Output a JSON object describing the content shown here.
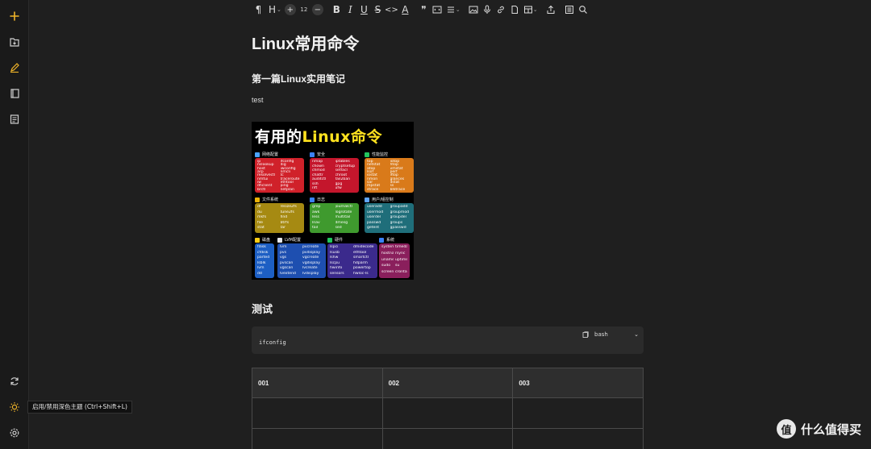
{
  "sidebar": {
    "items": [
      {
        "name": "new-note",
        "icon": "plus-icon"
      },
      {
        "name": "import",
        "icon": "folder-import-icon"
      },
      {
        "name": "edit",
        "icon": "pencil-icon"
      },
      {
        "name": "notebooks",
        "icon": "book-icon"
      },
      {
        "name": "outline",
        "icon": "list-icon"
      },
      {
        "name": "sync",
        "icon": "sync-icon"
      },
      {
        "name": "theme",
        "icon": "sun-icon"
      },
      {
        "name": "settings",
        "icon": "gear-icon"
      }
    ],
    "accent": "#f0b429"
  },
  "tooltip": "启用/禁用深色主题 (Ctrl+Shift+L)",
  "toolbar": {
    "paragraph": "¶",
    "heading": "H",
    "font_size": "12",
    "bold": "B",
    "italic": "I",
    "underline": "U",
    "strike": "S",
    "code": "<>",
    "text_color": "A",
    "quote": "❞"
  },
  "document": {
    "title": "Linux常用命令",
    "heading1": "第一篇Linux实用笔记",
    "paragraph": "test",
    "heading2": "测试",
    "code": {
      "language": "bash",
      "content": "ifconfig"
    },
    "table": {
      "headers": [
        "001",
        "002",
        "003"
      ],
      "rows": [
        [
          "",
          "",
          ""
        ],
        [
          "",
          "",
          ""
        ]
      ]
    }
  },
  "image": {
    "title_white": "有用的",
    "title_yellow": "Linux命令",
    "categories": [
      {
        "name": "网络配置",
        "color": "#d0212a",
        "icon_color": "#4aa3ff",
        "commands": [
          "ip",
          "ifconfig",
          "nslookup",
          "dig",
          "host",
          "iwconfig",
          "arp",
          "nmcli",
          "resolvectl",
          "tc",
          "nmtui",
          "traceroute",
          "iw",
          "ethtool",
          "dhclient",
          "ping",
          "brctl",
          "netplan"
        ]
      },
      {
        "name": "安全",
        "color": "#c4162c",
        "icon_color": "#3b82f6",
        "commands": [
          "nmap",
          "iptables",
          "chown",
          "cryptsetup",
          "chmod",
          "setfacl",
          "chattr",
          "chroot",
          "auditctl",
          "fail2ban",
          "ssh",
          "gpg",
          "nft",
          "ufw"
        ]
      },
      {
        "name": "性能监控",
        "color": "#d97a1a",
        "icon_color": "#22c55e",
        "commands": [
          "top",
          "iotop",
          "netstat",
          "htop",
          "atop",
          "vmstat",
          "lsof",
          "perf",
          "iostat",
          "iftop",
          "nmon",
          "glances",
          "sar",
          "dstat",
          "mpstat",
          "ss",
          "strace",
          "blktrace"
        ]
      },
      {
        "name": "文件系统",
        "color": "#a68a12",
        "icon_color": "#eab308",
        "commands": [
          "df",
          "resize2fs",
          "du",
          "tune2fs",
          "mkfs",
          "find",
          "file",
          "btrfs",
          "stat",
          "tar"
        ]
      },
      {
        "name": "日志",
        "color": "#3f9a2e",
        "icon_color": "#3b82f6",
        "commands": [
          "grep",
          "journalctl",
          "awk",
          "logrotate",
          "less",
          "multitail",
          "lnav",
          "dmesg",
          "tail",
          "sed"
        ]
      },
      {
        "name": "用户/组控制",
        "color": "#1f6e7a",
        "icon_color": "#60a5fa",
        "commands": [
          "useradd",
          "groupadd",
          "usermod",
          "groupmod",
          "userdel",
          "groupdel",
          "passwd",
          "groups",
          "getent",
          "gpasswd"
        ]
      },
      {
        "name": "磁盘",
        "color": "#1d5fc4",
        "icon_color": "#facc15",
        "commands": [
          "fdisk",
          "cfdisk",
          "parted",
          "lsblk",
          "lvm",
          "dd"
        ]
      },
      {
        "name": "LVM配置",
        "color": "#1e4fb0",
        "icon_color": "#e5e7eb",
        "commands": [
          "lvm",
          "pvcreate",
          "pvs",
          "pvdisplay",
          "vgs",
          "vgcreate",
          "pvscan",
          "vgdisplay",
          "vgscan",
          "lvcreate",
          "lvextend",
          "lvdisplay"
        ]
      },
      {
        "name": "硬件",
        "color": "#3b2a8c",
        "icon_color": "#22c55e",
        "commands": [
          "lspci",
          "dmidecode",
          "lsusb",
          "ethtool",
          "lshw",
          "smartctl",
          "lscpu",
          "hdparm",
          "hwinfo",
          "powertop",
          "sensors",
          "hwloc-ls"
        ]
      },
      {
        "name": "系统",
        "color": "#8a1f5c",
        "icon_color": "#3b82f6",
        "commands": [
          "systemctl",
          "timedatectl",
          "hostnamectl",
          "rsync",
          "uname",
          "uptime",
          "sudo",
          "su",
          "screen",
          "crontab"
        ]
      }
    ]
  },
  "watermark": {
    "logo": "值",
    "text": "什么值得买"
  }
}
